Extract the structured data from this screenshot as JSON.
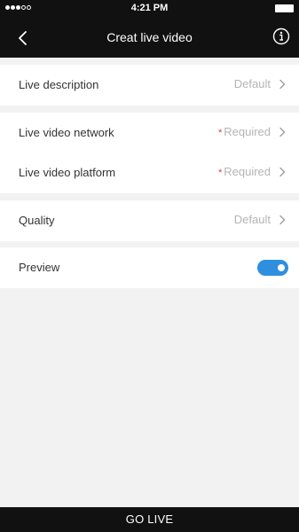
{
  "status_bar": {
    "time": "4:21 PM",
    "signal_bars_filled": 3,
    "signal_bars_total": 5
  },
  "nav": {
    "title": "Creat live video",
    "back_icon": "chevron-left-icon",
    "info_icon": "info-icon"
  },
  "settings": [
    {
      "label": "Live description",
      "value": "Default",
      "required": false
    },
    {
      "label": "Live video network",
      "value": "Required",
      "required": true
    },
    {
      "label": "Live video platform",
      "value": "Required",
      "required": true
    },
    {
      "label": "Quality",
      "value": "Default",
      "required": false
    }
  ],
  "preview": {
    "label": "Preview",
    "enabled": true
  },
  "footer": {
    "go_live_label": "GO LIVE"
  },
  "colors": {
    "bar_background": "#111111",
    "page_background": "#f2f2f2",
    "toggle_on": "#2f8fdf",
    "required_star": "#e03c3c",
    "value_text": "#b4b4b4"
  }
}
